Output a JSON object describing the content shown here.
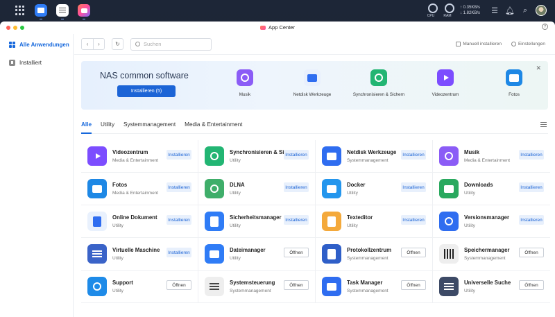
{
  "topbar": {
    "cpu_label": "CPU",
    "ram_label": "RAM",
    "net_up": "↑ 0.35KB/s",
    "net_down": "↓ 1.82KB/s"
  },
  "window": {
    "title": "App Center",
    "help": "?"
  },
  "sidebar": {
    "items": [
      {
        "label": "Alle Anwendungen"
      },
      {
        "label": "Installiert"
      }
    ]
  },
  "toolbar": {
    "search_placeholder": "Suchen",
    "manual_install": "Manuell installieren",
    "settings": "Einstellungen"
  },
  "banner": {
    "title": "NAS common software",
    "install_button": "Installieren (5)",
    "close": "✕",
    "items": [
      {
        "label": "Musik",
        "color": "#8b5cf6"
      },
      {
        "label": "Netdisk Werkzeuge",
        "color": "#2f6df0"
      },
      {
        "label": "Synchronisieren & Sichern",
        "color": "#22b573"
      },
      {
        "label": "Videozentrum",
        "color": "#7c4dff"
      },
      {
        "label": "Fotos",
        "color": "#1e88e5"
      }
    ]
  },
  "tabs": [
    {
      "label": "Alle"
    },
    {
      "label": "Utility"
    },
    {
      "label": "Systemmanagement"
    },
    {
      "label": "Media & Entertainment"
    }
  ],
  "apps": [
    {
      "name": "Videozentrum",
      "category": "Media & Entertainment",
      "button": "Installieren",
      "type": "install",
      "color": "#7c4dff",
      "icon": "video-icon"
    },
    {
      "name": "Synchronisieren & Sichern",
      "category": "Utility",
      "button": "Installieren",
      "type": "install",
      "color": "#22b573",
      "icon": "sync-icon"
    },
    {
      "name": "Netdisk Werkzeuge",
      "category": "Systemmanagement",
      "button": "Installieren",
      "type": "install",
      "color": "#2f6df0",
      "icon": "netdisk-icon"
    },
    {
      "name": "Musik",
      "category": "Media & Entertainment",
      "button": "Installieren",
      "type": "install",
      "color": "#8b5cf6",
      "icon": "music-icon"
    },
    {
      "name": "Fotos",
      "category": "Media & Entertainment",
      "button": "Installieren",
      "type": "install",
      "color": "#1e88e5",
      "icon": "photos-icon"
    },
    {
      "name": "DLNA",
      "category": "Utility",
      "button": "Installieren",
      "type": "install",
      "color": "#3fae6a",
      "icon": "dlna-icon"
    },
    {
      "name": "Docker",
      "category": "Utility",
      "button": "Installieren",
      "type": "install",
      "color": "#2496ed",
      "icon": "docker-icon"
    },
    {
      "name": "Downloads",
      "category": "Utility",
      "button": "Installieren",
      "type": "install",
      "color": "#2aa95f",
      "icon": "downloads-icon"
    },
    {
      "name": "Online Dokument",
      "category": "Utility",
      "button": "Installieren",
      "type": "install",
      "color": "#e9f1fd",
      "icon": "document-icon"
    },
    {
      "name": "Sicherheitsmanager",
      "category": "Utility",
      "button": "Installieren",
      "type": "install",
      "color": "#2f7cf6",
      "icon": "shield-icon"
    },
    {
      "name": "Texteditor",
      "category": "Utility",
      "button": "Installieren",
      "type": "install",
      "color": "#f4a93b",
      "icon": "texteditor-icon"
    },
    {
      "name": "Versionsmanager",
      "category": "Utility",
      "button": "Installieren",
      "type": "install",
      "color": "#2f6df0",
      "icon": "version-icon"
    },
    {
      "name": "Virtuelle Maschine",
      "category": "Utility",
      "button": "Installieren",
      "type": "install",
      "color": "#3a63c8",
      "icon": "vm-icon"
    },
    {
      "name": "Dateimanager",
      "category": "Utility",
      "button": "Öffnen",
      "type": "open",
      "color": "#2f7cf6",
      "icon": "folder-icon"
    },
    {
      "name": "Protokollzentrum",
      "category": "Systemmanagement",
      "button": "Öffnen",
      "type": "open",
      "color": "#2f5fc8",
      "icon": "log-icon"
    },
    {
      "name": "Speichermanager",
      "category": "Systemmanagement",
      "button": "Öffnen",
      "type": "open",
      "color": "#eeeeee",
      "icon": "storage-icon"
    },
    {
      "name": "Support",
      "category": "Utility",
      "button": "Öffnen",
      "type": "open",
      "color": "#1e8be8",
      "icon": "support-icon"
    },
    {
      "name": "Systemsteuerung",
      "category": "Systemmanagement",
      "button": "Öffnen",
      "type": "open",
      "color": "#eeeeee",
      "icon": "control-icon"
    },
    {
      "name": "Task Manager",
      "category": "Systemmanagement",
      "button": "Öffnen",
      "type": "open",
      "color": "#2f6df0",
      "icon": "taskmanager-icon"
    },
    {
      "name": "Universelle Suche",
      "category": "Utility",
      "button": "Öffnen",
      "type": "open",
      "color": "#3d4a66",
      "icon": "search-icon"
    }
  ]
}
